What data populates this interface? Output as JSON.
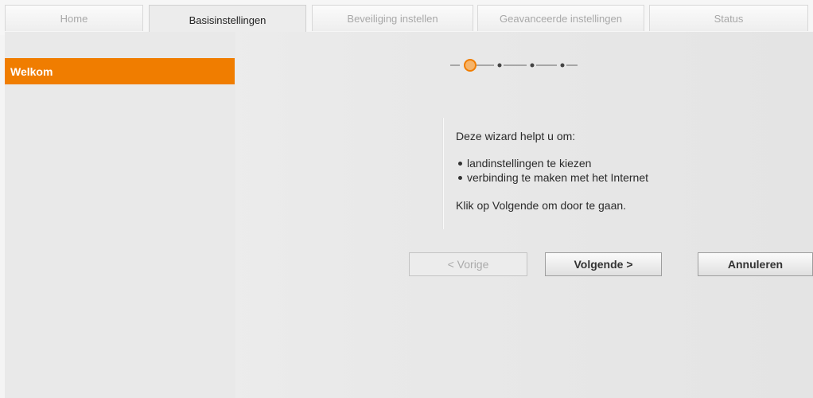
{
  "tabs": [
    {
      "label": "Home"
    },
    {
      "label": "Basisinstellingen"
    },
    {
      "label": "Beveiliging instellen"
    },
    {
      "label": "Geavanceerde instellingen"
    },
    {
      "label": "Status"
    }
  ],
  "active_tab": "Basisinstellingen",
  "sidebar": {
    "items": [
      {
        "label": "Welkom"
      }
    ]
  },
  "wizard": {
    "total_steps": 4,
    "current_step": 1,
    "intro": "Deze wizard helpt u om:",
    "bullets": [
      "landinstellingen te kiezen",
      "verbinding te maken met het Internet"
    ],
    "continue_text": "Klik op Volgende om door te gaan."
  },
  "buttons": {
    "prev": "< Vorige",
    "next": "Volgende >",
    "cancel": "Annuleren"
  },
  "colors": {
    "accent": "#f07d00",
    "background": "#f4f4f4"
  }
}
